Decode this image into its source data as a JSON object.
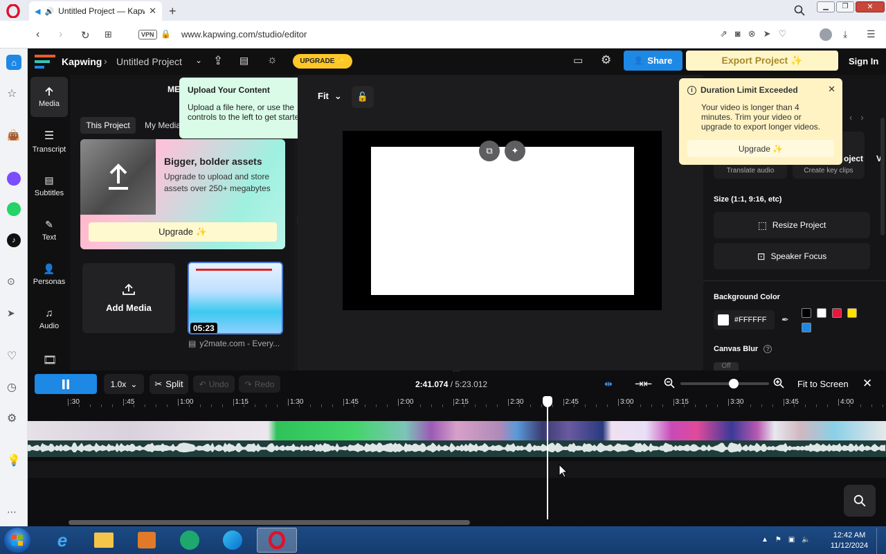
{
  "browser": {
    "tab_title": "Untitled Project — Kapwing",
    "new_tab": "+",
    "url": "www.kapwing.com/studio/editor",
    "vpn": "VPN"
  },
  "topbar": {
    "brand": "Kapwing",
    "project": "Untitled Project",
    "upgrade": "UPGRADE ✨",
    "share": "Share",
    "export": "Export Project ✨",
    "signin": "Sign In"
  },
  "leftnav": [
    {
      "label": "Media",
      "icon": "upload-icon"
    },
    {
      "label": "Transcript",
      "icon": "transcript-icon"
    },
    {
      "label": "Subtitles",
      "icon": "subtitles-icon"
    },
    {
      "label": "Text",
      "icon": "text-icon"
    },
    {
      "label": "Personas",
      "icon": "personas-icon"
    },
    {
      "label": "Audio",
      "icon": "audio-icon"
    }
  ],
  "media": {
    "header": "ME",
    "tab_this": "This Project",
    "tab_my": "My Media",
    "promo_title": "Bigger, bolder assets",
    "promo_body": "Upgrade to upload and store assets over 250+ megabytes",
    "promo_button": "Upgrade ✨",
    "add_media": "Add Media",
    "clip_duration": "05:23",
    "clip_name": "y2mate.com - Every..."
  },
  "upload_tooltip": {
    "title": "Upload Your Content",
    "body": "Upload a file here, or use the controls to the left to get started."
  },
  "canvas": {
    "fit": "Fit"
  },
  "duration_popup": {
    "title": "Duration Limit Exceeded",
    "body": "Your video is longer than 4 minutes. Trim your video or upgrade to export longer videos.",
    "button": "Upgrade ✨"
  },
  "right": {
    "partial_1": "oject",
    "partial_2": "V",
    "translate": "Translate audio",
    "keyclips": "Create key clips",
    "size_label": "Size (1:1, 9:16, etc)",
    "resize": "Resize Project",
    "speaker": "Speaker Focus",
    "bg_label": "Background Color",
    "bg_value": "#FFFFFF",
    "swatches": [
      "#000000",
      "#ffffff",
      "#e8173c",
      "#ffe000",
      "#1e88e5"
    ],
    "blur_label": "Canvas Blur",
    "blur_partial": "Off"
  },
  "timeline": {
    "speed": "1.0x",
    "split": "Split",
    "undo": "Undo",
    "redo": "Redo",
    "time_current": "2:41.074",
    "time_total": " / 5:23.012",
    "fit_screen": "Fit to Screen",
    "zoom_level": 0.6,
    "ticks": [
      ":30",
      ":45",
      "1:00",
      "1:15",
      "1:30",
      "1:45",
      "2:00",
      "2:15",
      "2:30",
      "2:45",
      "3:00",
      "3:15",
      "3:30",
      "3:45",
      "4:00"
    ]
  },
  "taskbar": {
    "time": "12:42 AM",
    "date": "11/12/2024"
  },
  "colors": {
    "accent_blue": "#1e88e5",
    "upgrade_yellow": "#ffc727",
    "export_bg": "#fff6c8",
    "tooltip_green": "#d9fbe8"
  }
}
